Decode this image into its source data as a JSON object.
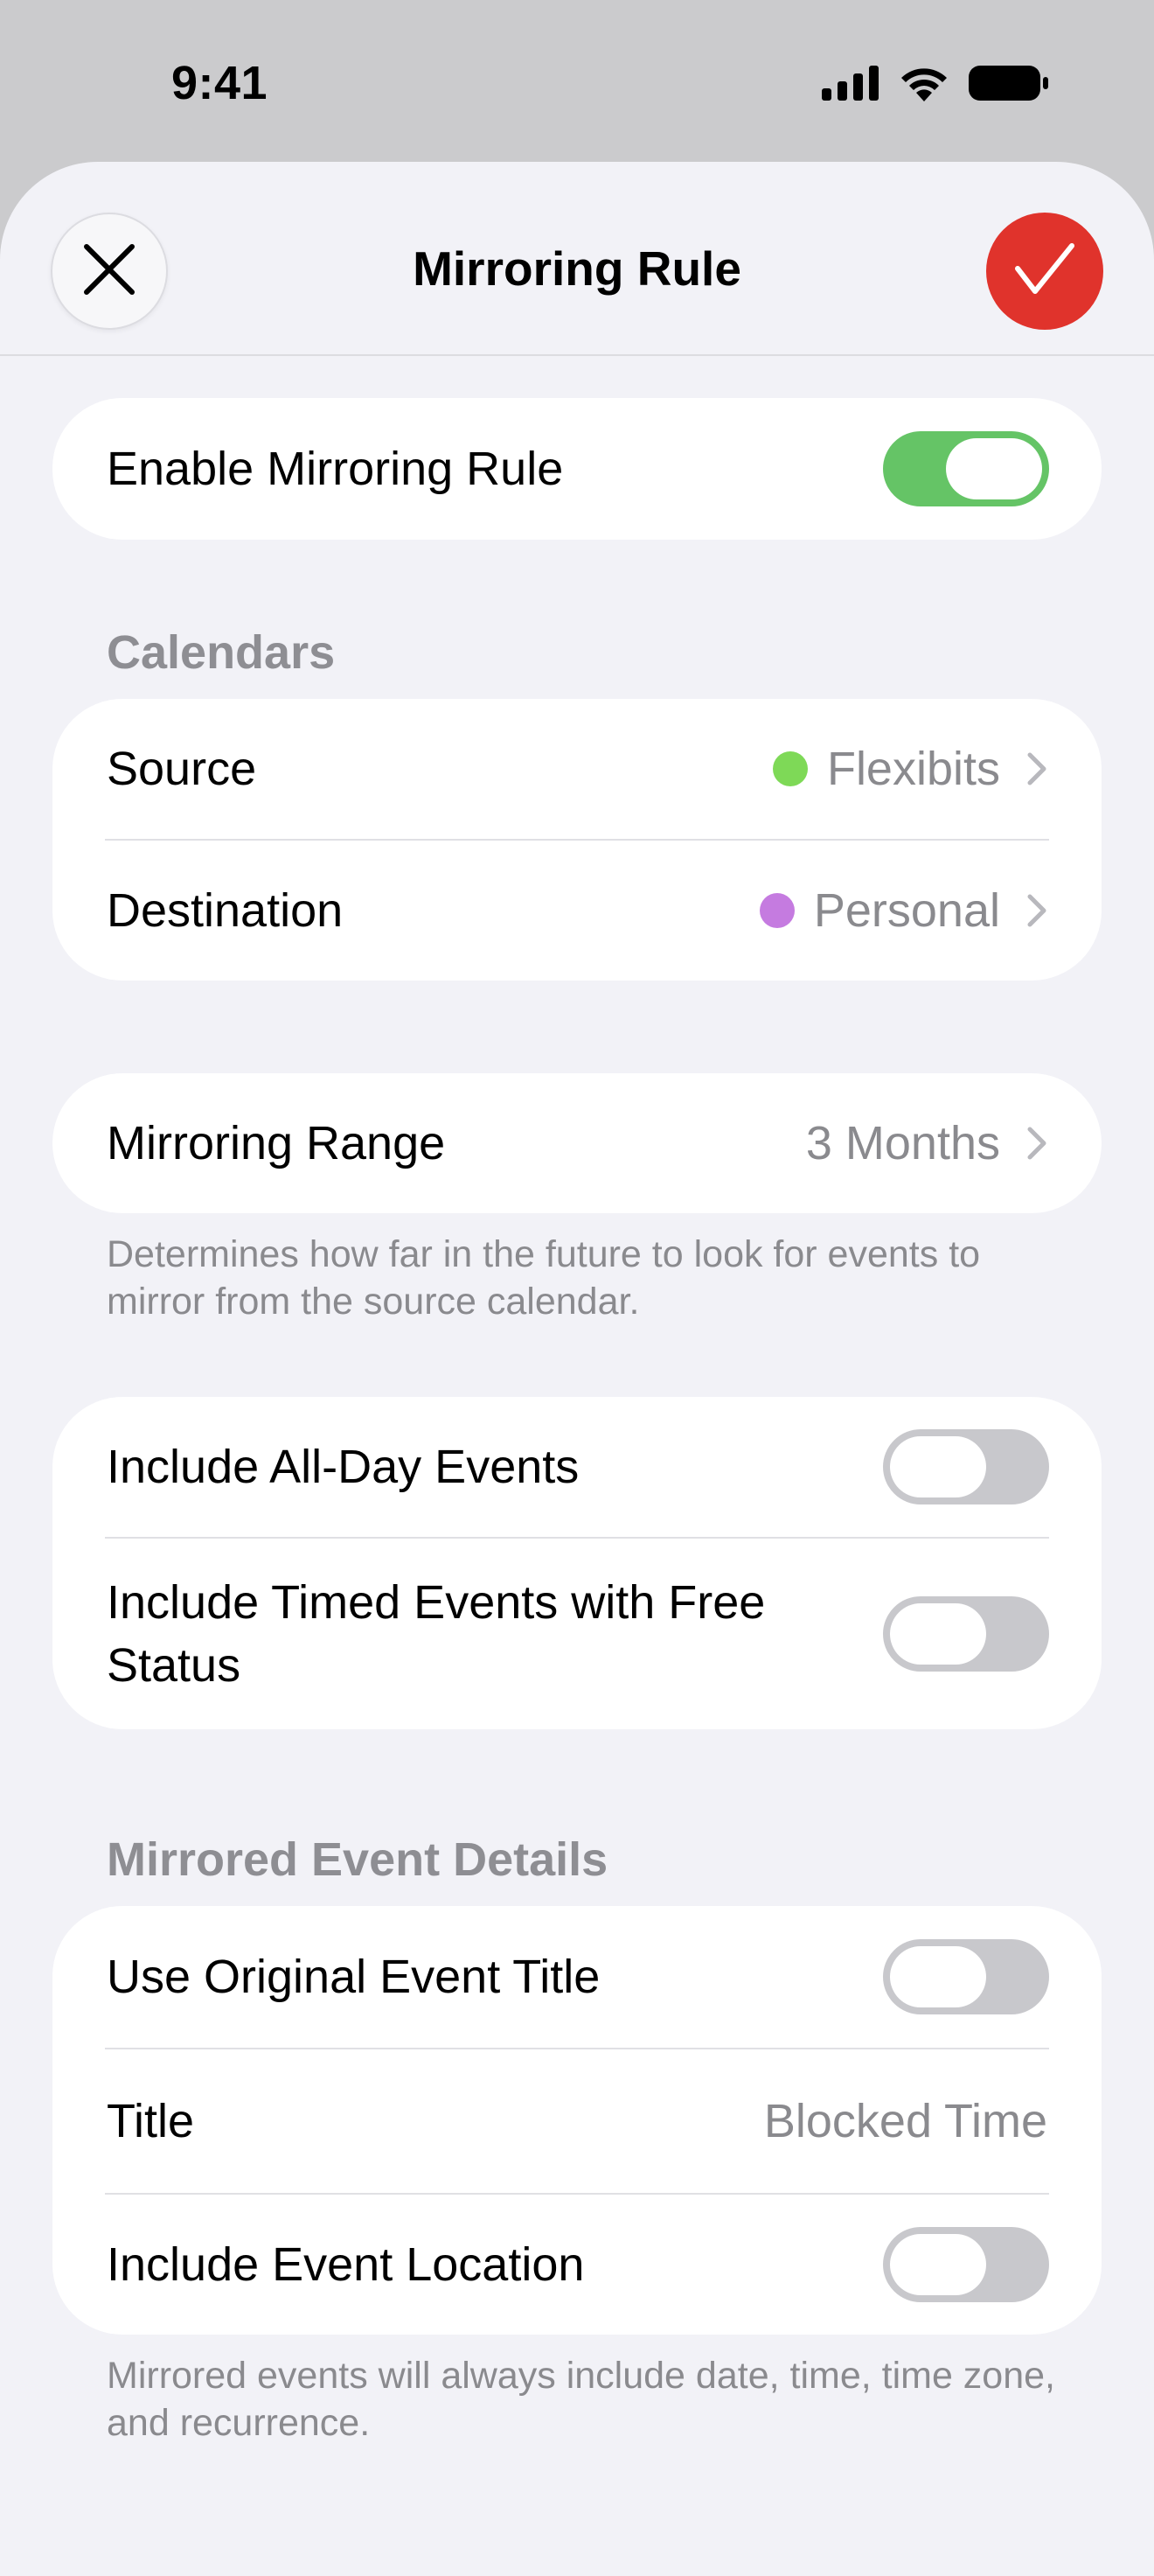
{
  "status_bar": {
    "time": "9:41",
    "icons": [
      "cellular-signal-icon",
      "wifi-icon",
      "battery-icon"
    ]
  },
  "nav": {
    "title": "Mirroring Rule",
    "close_icon": "close-icon",
    "confirm_icon": "checkmark-icon"
  },
  "colors": {
    "accent_red": "#e0332c",
    "toggle_on": "#65c466",
    "flexibits_dot": "#7ed957",
    "personal_dot": "#c57be0"
  },
  "enable_rule": {
    "label": "Enable Mirroring Rule",
    "on": true
  },
  "calendars": {
    "header": "Calendars",
    "source": {
      "label": "Source",
      "value": "Flexibits"
    },
    "destination": {
      "label": "Destination",
      "value": "Personal"
    }
  },
  "range": {
    "label": "Mirroring Range",
    "value": "3 Months",
    "note": "Determines how far in the future to look for events to mirror from the source calendar."
  },
  "filters": {
    "all_day": {
      "label": "Include All-Day Events",
      "on": false
    },
    "free_status": {
      "label": "Include Timed Events with Free Status",
      "on": false
    }
  },
  "details": {
    "header": "Mirrored Event Details",
    "original_title": {
      "label": "Use Original Event Title",
      "on": false
    },
    "title": {
      "label": "Title",
      "value": "Blocked Time"
    },
    "location": {
      "label": "Include Event Location",
      "on": false
    },
    "note": "Mirrored events will always include date, time, time zone, and recurrence."
  }
}
